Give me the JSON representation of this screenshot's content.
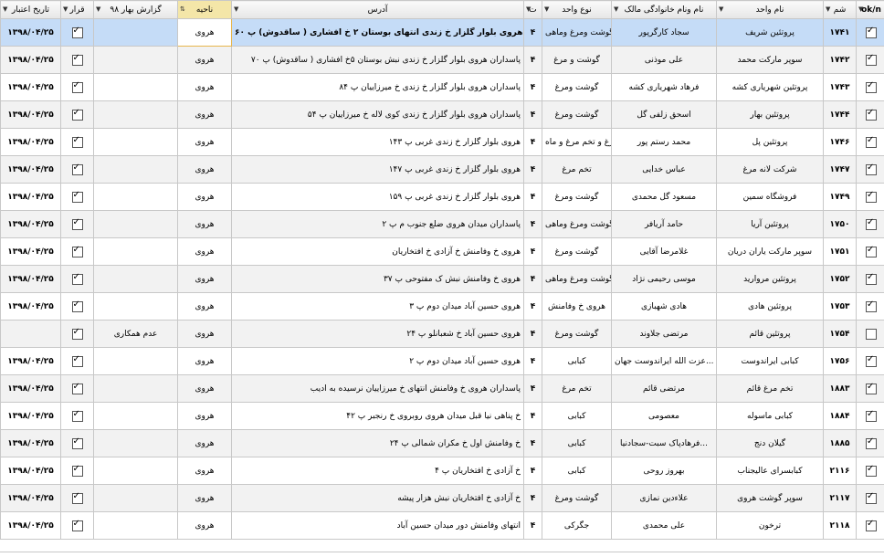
{
  "columns": {
    "date": "تاریخ اعتبار",
    "contract": "قرار",
    "report": "گزارش بهار ۹۸",
    "area": "ناحیه",
    "address": "آدرس",
    "num": "ت",
    "unit_type": "نوع واحد",
    "owner": "نام ونام خانوادگی مالک",
    "unit_name": "نام واحد",
    "code": "شم",
    "ok": "ok/n"
  },
  "rows": [
    {
      "date": "۱۳۹۸/۰۴/۲۵",
      "contract": true,
      "report": "",
      "area": "هروی",
      "address": "پاسداران هروی بلوار گلزار خ زندی انتهای بوستان ۲ خ افشاری ( ساقدوش) پ ۶۰",
      "num": "۴",
      "unit_type": "گوشت ومرغ وماهی",
      "owner": "سجاد کارگرپور",
      "unit_name": "پروتئین شریف",
      "code": "۱۷۴۱",
      "ok": true
    },
    {
      "date": "۱۳۹۸/۰۴/۲۵",
      "contract": true,
      "report": "",
      "area": "هروی",
      "address": "پاسداران هروی بلوار گلزار خ زندی نبش بوستان ۵خ افشاری ( ساقدوش) پ ۷۰",
      "num": "۴",
      "unit_type": "گوشت و مرغ",
      "owner": "علی موذنی",
      "unit_name": "سوپر مارکت محمد",
      "code": "۱۷۴۲",
      "ok": true
    },
    {
      "date": "۱۳۹۸/۰۴/۲۵",
      "contract": true,
      "report": "",
      "area": "هروی",
      "address": "پاسداران هروی بلوار گلزار خ زندی خ میرزاییان پ ۸۴",
      "num": "۴",
      "unit_type": "گوشت ومرغ",
      "owner": "فرهاد شهریاری کشه",
      "unit_name": "پروتئین شهریاری کشه",
      "code": "۱۷۴۳",
      "ok": true
    },
    {
      "date": "۱۳۹۸/۰۴/۲۵",
      "contract": true,
      "report": "",
      "area": "هروی",
      "address": "پاسداران هروی بلوار گلزار خ زندی کوی لاله خ میرزاییان پ ۵۴",
      "num": "۴",
      "unit_type": "گوشت ومرغ",
      "owner": "اسحق زلفی گل",
      "unit_name": "پروتئین بهار",
      "code": "۱۷۴۴",
      "ok": true
    },
    {
      "date": "۱۳۹۸/۰۴/۲۵",
      "contract": true,
      "report": "",
      "area": "هروی",
      "address": "هروی بلوار گلزار خ زندی غربی پ ۱۴۳",
      "num": "۴",
      "unit_type": "مرغ و تخم مرغ و ماه...",
      "owner": "محمد رستم پور",
      "unit_name": "پروتئین پل",
      "code": "۱۷۴۶",
      "ok": true
    },
    {
      "date": "۱۳۹۸/۰۴/۲۵",
      "contract": true,
      "report": "",
      "area": "هروی",
      "address": "هروی بلوار گلزار خ زندی غربی پ ۱۴۷",
      "num": "۴",
      "unit_type": "تخم مرغ",
      "owner": "عباس خدایی",
      "unit_name": "شرکت لانه مرغ",
      "code": "۱۷۴۷",
      "ok": true
    },
    {
      "date": "۱۳۹۸/۰۴/۲۵",
      "contract": true,
      "report": "",
      "area": "هروی",
      "address": "هروی بلوار گلزار خ زندی غربی پ ۱۵۹",
      "num": "۴",
      "unit_type": "گوشت ومرغ",
      "owner": "مسعود گل محمدی",
      "unit_name": "فروشگاه سمین",
      "code": "۱۷۴۹",
      "ok": true
    },
    {
      "date": "۱۳۹۸/۰۴/۲۵",
      "contract": true,
      "report": "",
      "area": "هروی",
      "address": "پاسداران میدان هروی ضلع جنوب م پ ۲",
      "num": "۴",
      "unit_type": "گوشت ومرغ وماهی",
      "owner": "حامد آریافر",
      "unit_name": "پروتئین آریا",
      "code": "۱۷۵۰",
      "ok": true
    },
    {
      "date": "۱۳۹۸/۰۴/۲۵",
      "contract": true,
      "report": "",
      "area": "هروی",
      "address": "هروی خ وفامنش خ آزادی خ افتخاریان",
      "num": "۴",
      "unit_type": "گوشت ومرغ",
      "owner": "غلامرضا آقایی",
      "unit_name": "سوپر مارکت یاران دریان",
      "code": "۱۷۵۱",
      "ok": true
    },
    {
      "date": "۱۳۹۸/۰۴/۲۵",
      "contract": true,
      "report": "",
      "area": "هروی",
      "address": "هروی خ وفامنش نبش ک مفتوحی پ ۳۷",
      "num": "۴",
      "unit_type": "گوشت ومرغ وماهی",
      "owner": "موسی رحیمی نژاد",
      "unit_name": "پروتئین مروارید",
      "code": "۱۷۵۲",
      "ok": true
    },
    {
      "date": "۱۳۹۸/۰۴/۲۵",
      "contract": true,
      "report": "",
      "area": "هروی",
      "address": "هروی حسین آباد میدان دوم پ ۳",
      "num": "۴",
      "unit_type": "هروی خ وفامنش",
      "owner": "هادی شهبازی",
      "unit_name": "پروتئین هادی",
      "code": "۱۷۵۳",
      "ok": true
    },
    {
      "date": "",
      "contract": true,
      "report": "عدم همکاری",
      "area": "هروی",
      "address": "هروی حسین آباد خ شعبانلو پ ۲۴",
      "num": "۴",
      "unit_type": "گوشت ومرغ",
      "owner": "مرتضی جلاوند",
      "unit_name": "پروتئین قائم",
      "code": "۱۷۵۴",
      "ok": false
    },
    {
      "date": "۱۳۹۸/۰۴/۲۵",
      "contract": true,
      "report": "",
      "area": "هروی",
      "address": "هروی حسین آباد میدان دوم پ ۲",
      "num": "۴",
      "unit_type": "کبابی",
      "owner": "عزت الله ایراندوست جهان...",
      "unit_name": "کبابی ایراندوست",
      "code": "۱۷۵۶",
      "ok": true
    },
    {
      "date": "۱۳۹۸/۰۴/۲۵",
      "contract": true,
      "report": "",
      "area": "هروی",
      "address": "پاسداران هروی خ وفامنش انتهای خ میرزاییان نرسیده به ادیب",
      "num": "۴",
      "unit_type": "تخم مرغ",
      "owner": "مرتضی قائم",
      "unit_name": "تخم مرغ قائم",
      "code": "۱۸۸۳",
      "ok": true
    },
    {
      "date": "۱۳۹۸/۰۴/۲۵",
      "contract": true,
      "report": "",
      "area": "هروی",
      "address": "خ پناهی نیا قبل میدان هروی روبروی خ رنجبر پ ۴۲",
      "num": "۴",
      "unit_type": "کبابی",
      "owner": "معصومی",
      "unit_name": "کبابی ماسوله",
      "code": "۱۸۸۴",
      "ok": true
    },
    {
      "date": "۱۳۹۸/۰۴/۲۵",
      "contract": true,
      "report": "",
      "area": "هروی",
      "address": "خ وفامنش اول خ مکران شمالی پ ۲۴",
      "num": "۴",
      "unit_type": "کبابی",
      "owner": "فرهادپاک سبت-سجادنیا...",
      "unit_name": "گیلان دنج",
      "code": "۱۸۸۵",
      "ok": true
    },
    {
      "date": "۱۳۹۸/۰۴/۲۵",
      "contract": true,
      "report": "",
      "area": "هروی",
      "address": "خ آزادی خ افتخاریان پ ۴",
      "num": "۴",
      "unit_type": "کبابی",
      "owner": "بهروز روحی",
      "unit_name": "کبابسرای عالیجناب",
      "code": "۲۱۱۶",
      "ok": true
    },
    {
      "date": "۱۳۹۸/۰۴/۲۵",
      "contract": true,
      "report": "",
      "area": "هروی",
      "address": "خ آزادی خ افتخاریان نبش هزار پیشه",
      "num": "۴",
      "unit_type": "گوشت ومرغ",
      "owner": "علاءدین نمازی",
      "unit_name": "سوپر گوشت هروی",
      "code": "۲۱۱۷",
      "ok": true
    },
    {
      "date": "۱۳۹۸/۰۴/۲۵",
      "contract": true,
      "report": "",
      "area": "هروی",
      "address": "انتهای وفامنش دور میدان حسین آباد",
      "num": "۴",
      "unit_type": "جگرکی",
      "owner": "علی محمدی",
      "unit_name": "ترخون",
      "code": "۲۱۱۸",
      "ok": true
    }
  ]
}
